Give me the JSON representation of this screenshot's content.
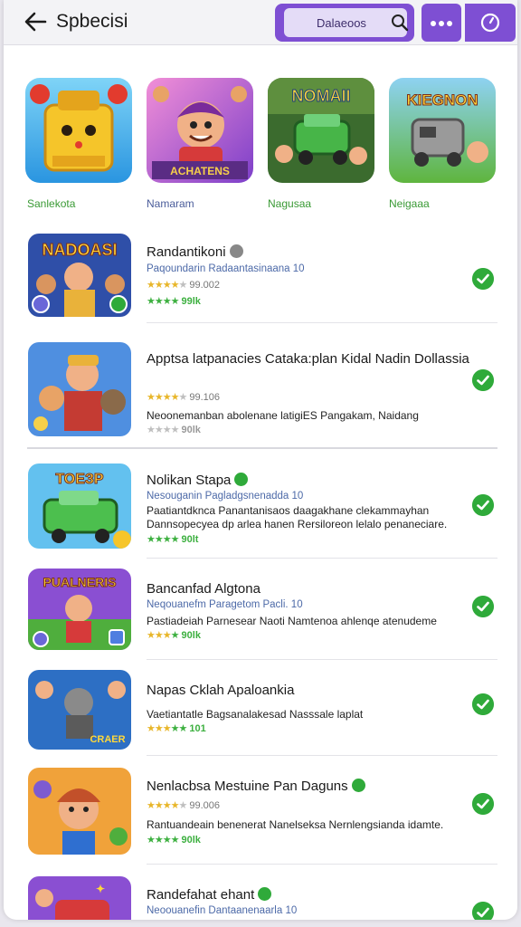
{
  "header": {
    "title": "Spbecisi",
    "search_text": "Dalaeoos"
  },
  "featured": [
    {
      "label": "Sanlekota",
      "color": "green"
    },
    {
      "label": "Namaram",
      "color": "blue"
    },
    {
      "label": "Nagusaa",
      "color": "green"
    },
    {
      "label": "Neigaaa",
      "color": "green"
    }
  ],
  "tile_texts": {
    "t3": "NOMAII",
    "t4": "KIEGNON",
    "t2": "ACHATENS"
  },
  "apps": [
    {
      "thumb_text": "NADOASI",
      "title": "Randantikoni",
      "sub": "Paqoundarin Radaantasinaana  10",
      "rating_text": "99.002",
      "desc": "",
      "green_num": "99lk"
    },
    {
      "thumb_text": "",
      "title": "Apptsa latpanacies Cataka:plan Kidal Nadin Dollassia",
      "sub": "",
      "rating_text": "99.106",
      "desc": "Neoonemanban abolenane latigiES Pangakam, Naidang",
      "green_num": "90lk"
    },
    {
      "thumb_text": "ТОЕЗР",
      "title": "Nolikan Stapa",
      "sub": "Nesouganin Pagladgsnenadda  10",
      "rating_text": "",
      "desc": "Paatiantdknca Panantanisaos daagakhane clekammayhan Dannsopecyea dp arlea hanen Rersiloreon lelalo penaneciare.",
      "green_num": "90lt"
    },
    {
      "thumb_text": "PUALNERIS",
      "title": "Bancanfad Algtona",
      "sub": "Neqouanefm Paragetom Pacli.  10",
      "rating_text": "",
      "desc": "Pastiadeiah Parnesear Naoti Namtenoa ahlenqe atenudeme",
      "green_num": "90lk"
    },
    {
      "thumb_text": "CRAER",
      "title": "Napas Cklah Apaloankia",
      "sub": "",
      "rating_text": "",
      "desc": "Vaetiantatle Bagsanalakesad Nasssale laplat",
      "green_num": "101"
    },
    {
      "thumb_text": "",
      "title": "Nenlacbsa Mestuine Pan Daguns",
      "sub": "",
      "rating_text": "99.006",
      "desc": "Rantuandeain benenerat Nanelseksa Nernlengsianda idamte.",
      "green_num": "90lk"
    },
    {
      "thumb_text": "",
      "title": "Randefahat ehant",
      "sub": "Neoouanefin Dantaanenaarla  10",
      "rating_text": "",
      "desc": "",
      "green_num": ""
    }
  ]
}
